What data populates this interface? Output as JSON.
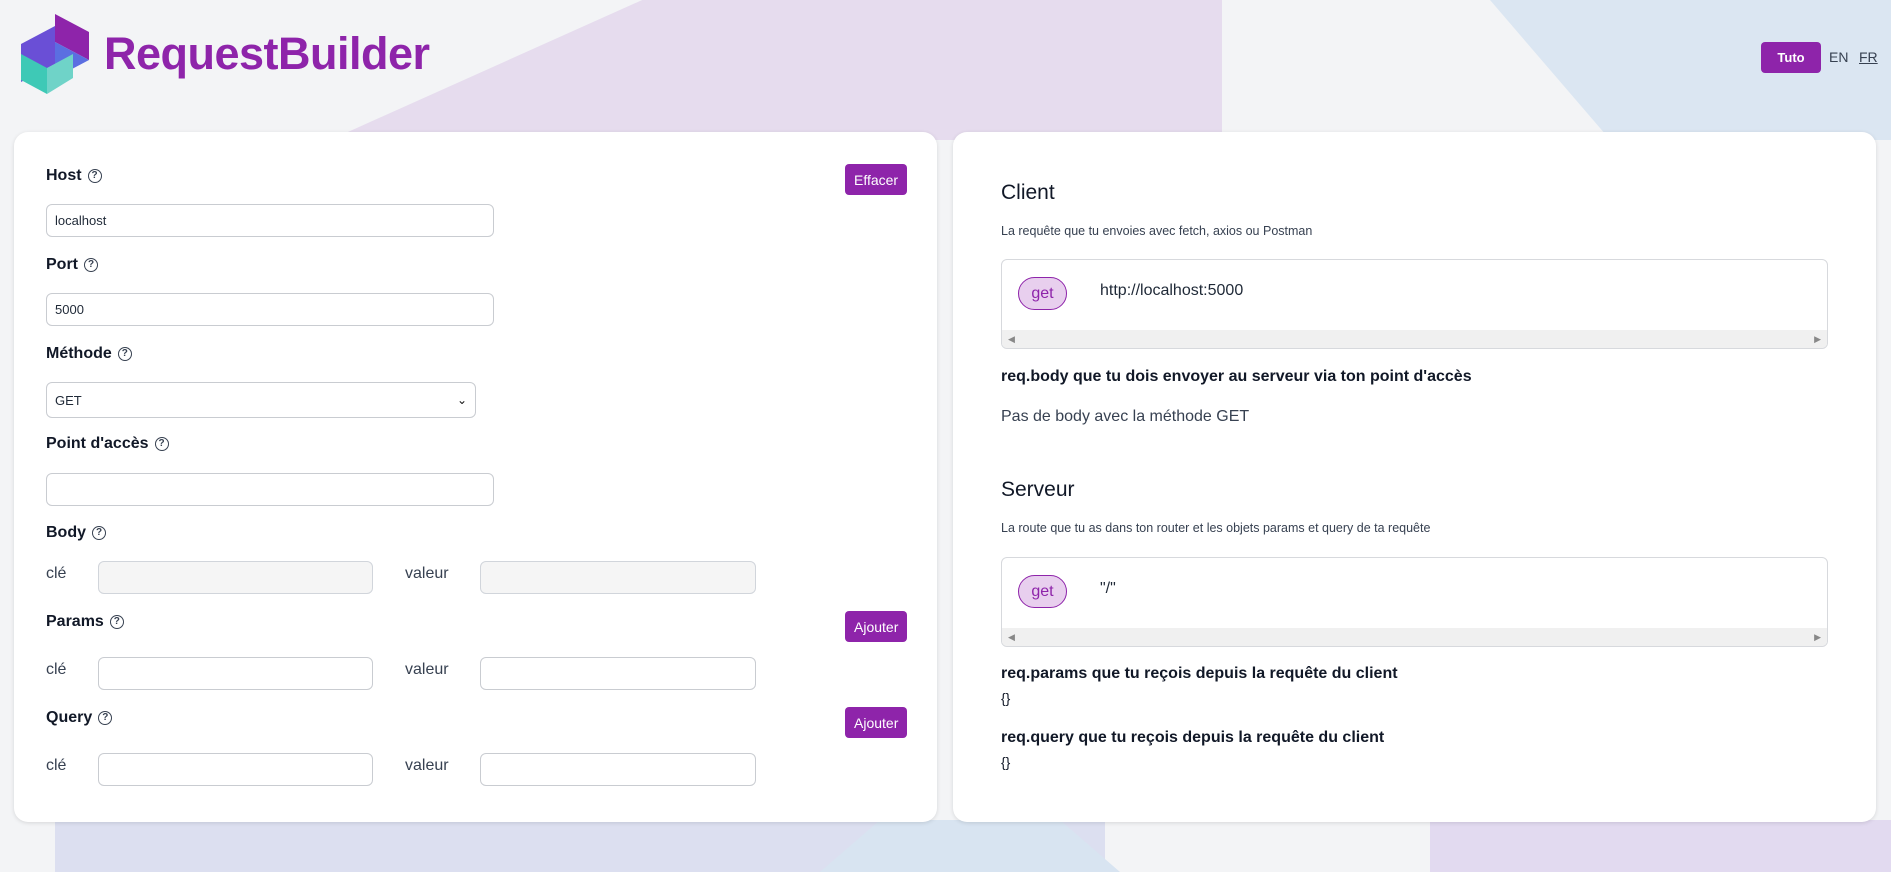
{
  "header": {
    "brand": "RequestBuilder",
    "tuto_label": "Tuto",
    "lang_en": "EN",
    "lang_fr": "FR"
  },
  "form": {
    "clear_label": "Effacer",
    "host_label": "Host",
    "host_value": "localhost",
    "port_label": "Port",
    "port_value": "5000",
    "method_label": "Méthode",
    "method_value": "GET",
    "endpoint_label": "Point d'accès",
    "endpoint_value": "",
    "body_label": "Body",
    "params_label": "Params",
    "query_label": "Query",
    "key_label": "clé",
    "value_label": "valeur",
    "add_label": "Ajouter"
  },
  "client": {
    "title": "Client",
    "subtitle": "La requête que tu envoies avec fetch, axios ou Postman",
    "method": "get",
    "url": "http://localhost:5000",
    "body_heading": "req.body que tu dois envoyer au serveur via ton point d'accès",
    "body_text": "Pas de body avec la méthode GET"
  },
  "server": {
    "title": "Serveur",
    "subtitle": "La route que tu as dans ton router et les objets params et query de ta requête",
    "method": "get",
    "route": "\"/\"",
    "params_heading": "req.params que tu reçois depuis la requête du client",
    "params_value": "{}",
    "query_heading": "req.query que tu reçois depuis la requête du client",
    "query_value": "{}"
  },
  "colors": {
    "accent": "#8e24aa",
    "pill_bg": "#e8cfee"
  }
}
